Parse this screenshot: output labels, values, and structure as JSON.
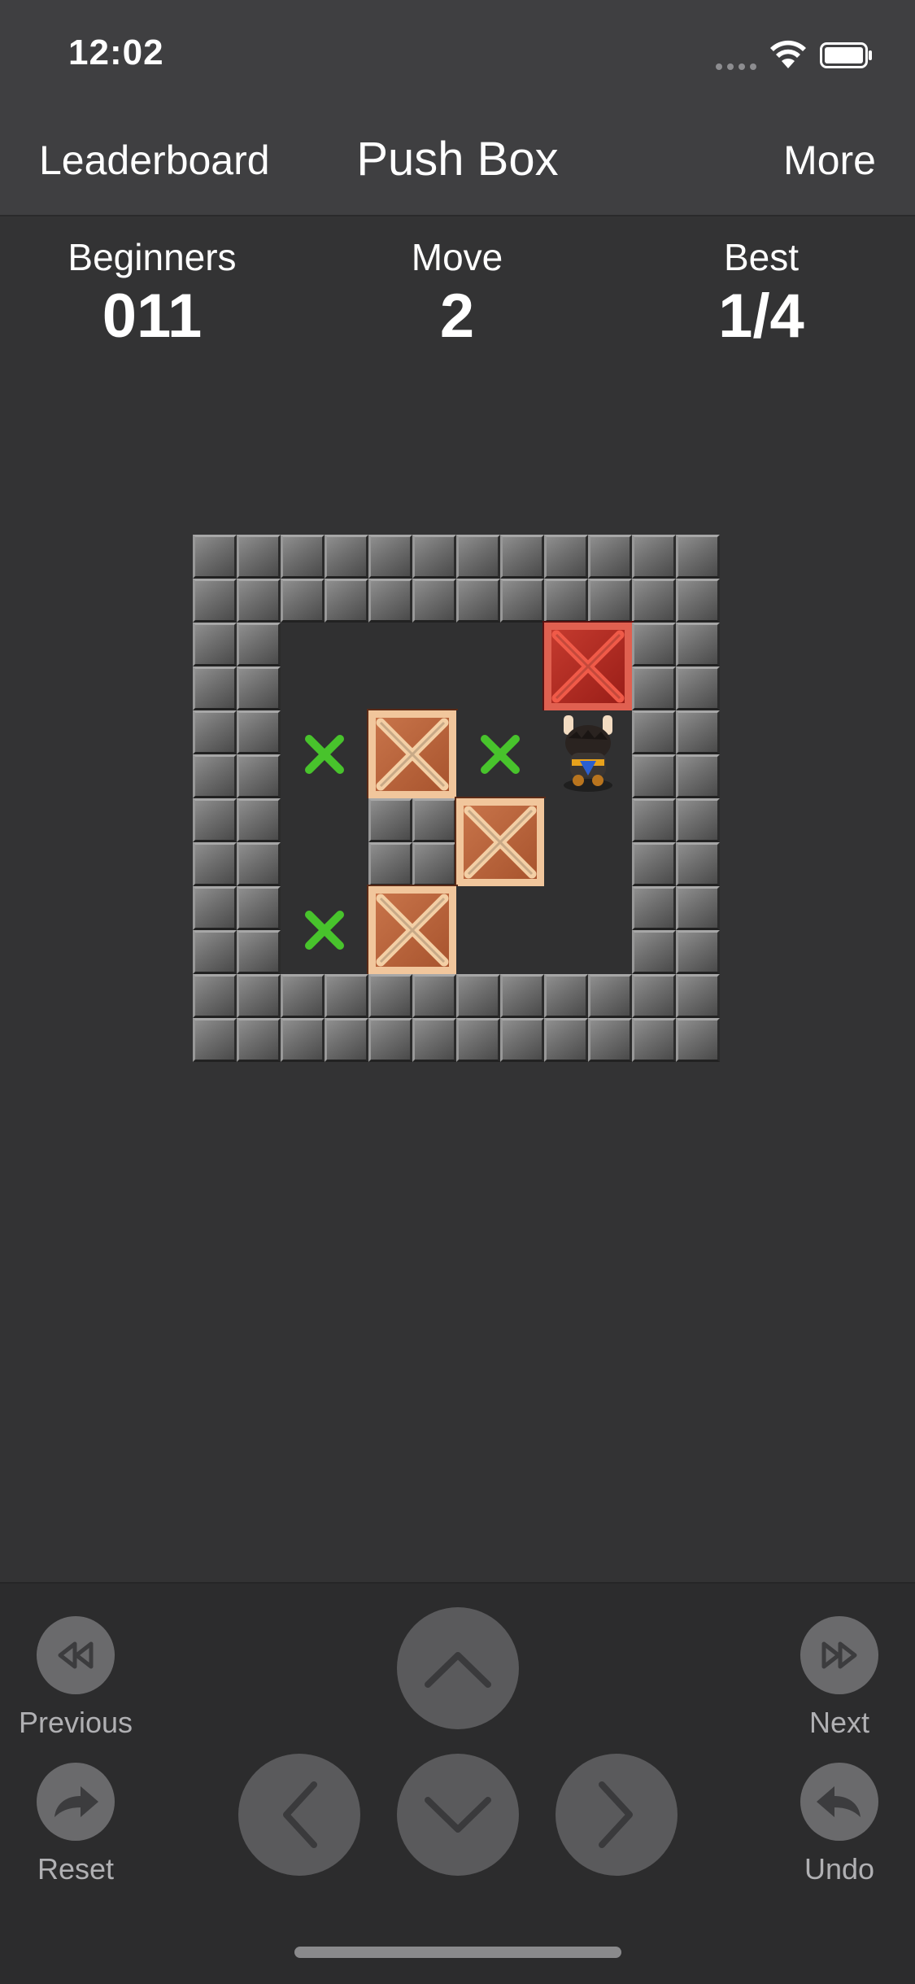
{
  "status_bar": {
    "time": "12:02"
  },
  "nav": {
    "left": "Leaderboard",
    "title": "Push Box",
    "right": "More"
  },
  "stats": [
    {
      "label": "Beginners",
      "value": "011"
    },
    {
      "label": "Move",
      "value": "2"
    },
    {
      "label": "Best",
      "value": "1/4"
    }
  ],
  "controls": {
    "previous": "Previous",
    "next": "Next",
    "reset": "Reset",
    "undo": "Undo"
  },
  "level_map": [
    "######",
    "#   *#",
    "#.$.@#",
    "# #$ #",
    "#.$  #",
    "######"
  ]
}
